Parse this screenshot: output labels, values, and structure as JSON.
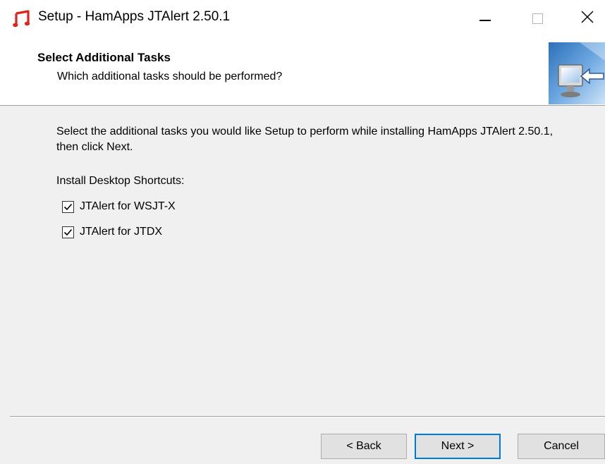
{
  "window": {
    "title": "Setup - HamApps JTAlert 2.50.1",
    "icon": "music-note-icon",
    "controls": {
      "minimize": "minimize-icon",
      "maximize": "maximize-icon",
      "close": "close-icon"
    }
  },
  "header": {
    "title": "Select Additional Tasks",
    "subtitle": "Which additional tasks should be performed?",
    "image": "setup-monitor-icon"
  },
  "content": {
    "intro": "Select the additional tasks you would like Setup to perform while installing HamApps JTAlert 2.50.1, then click Next.",
    "group_label": "Install Desktop Shortcuts:",
    "tasks": [
      {
        "label": "JTAlert for WSJT-X",
        "checked": true
      },
      {
        "label": "JTAlert for JTDX",
        "checked": true
      }
    ]
  },
  "buttons": {
    "back": "< Back",
    "next": "Next >",
    "cancel": "Cancel"
  },
  "colors": {
    "accent": "#0078d7",
    "background": "#f0f0f0",
    "icon_red": "#e0231b"
  }
}
